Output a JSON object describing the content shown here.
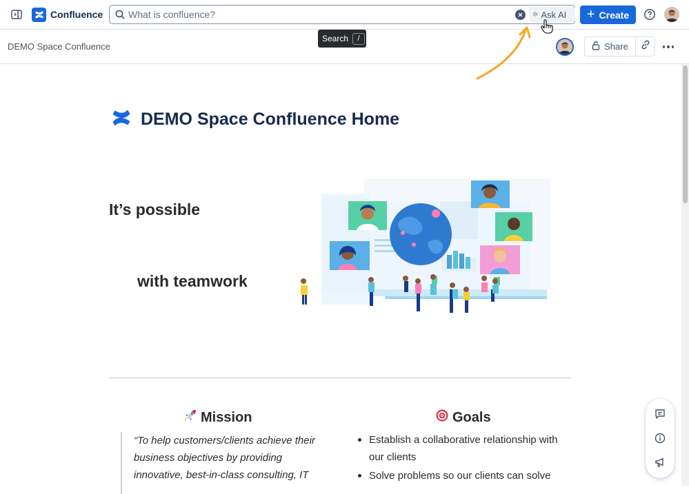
{
  "topnav": {
    "app_name": "Confluence",
    "search_placeholder": "What is confluence?",
    "ask_ai_label": "Ask AI",
    "create_label": "Create",
    "tooltip": {
      "label": "Search",
      "shortcut": "/"
    }
  },
  "page_header": {
    "breadcrumb": "DEMO Space Confluence",
    "share_label": "Share"
  },
  "content": {
    "title": "DEMO Space Confluence Home",
    "hero_line_1": "It’s possible",
    "hero_line_2": "with teamwork",
    "mission": {
      "heading": "Mission",
      "icon": "rocket-icon",
      "quote": "“To help customers/clients achieve their business objectives by providing innovative, best-in-class consulting, IT"
    },
    "goals": {
      "heading": "Goals",
      "icon": "target-icon",
      "items": [
        "Establish a collaborative relationship with our clients",
        "Solve problems so our clients can solve"
      ]
    }
  },
  "colors": {
    "brand": "#1868db",
    "annotation_arrow": "#f5a623"
  }
}
